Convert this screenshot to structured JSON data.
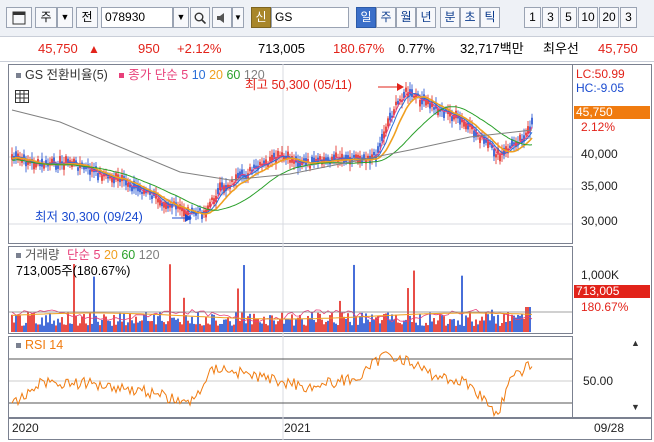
{
  "toolbar": {
    "type_label": "주",
    "code_label": "전",
    "code_value": "078930",
    "credit_badge": "신",
    "stock_name": "GS",
    "period_tabs": [
      "일",
      "주",
      "월",
      "년",
      "분",
      "초",
      "틱"
    ],
    "active_period": "일",
    "interval_numbers": [
      "1",
      "3",
      "5",
      "10",
      "20",
      "3"
    ]
  },
  "quote": {
    "price": "45,750",
    "change_arrow": "▲",
    "change": "950",
    "change_pct": "+2.12%",
    "volume": "713,005",
    "volume_ratio": "180.67%",
    "turnover": "0.77%",
    "amount": "32,717백만",
    "best_label": "최우선",
    "best_price": "45,750"
  },
  "price_panel": {
    "title": "GS 전환비율(5)",
    "ma_legend_prefix": "종가 단순",
    "ma_periods": [
      "5",
      "10",
      "20",
      "60",
      "120"
    ],
    "ma_colors": [
      "#e8407a",
      "#2a6fd8",
      "#f0a020",
      "#2aa02a",
      "#808080"
    ],
    "high_annotation": "최고 50,300 (05/11)",
    "low_annotation": "최저 30,300 (09/24)",
    "lc_label": "LC:50.99",
    "hc_label": "HC:-9.05",
    "current_price_tag": "45,750",
    "current_pct_tag": "2.12%",
    "y_ticks": [
      "40,000",
      "35,000",
      "30,000"
    ]
  },
  "volume_panel": {
    "legend_prefix": "거래량",
    "legend_ma_prefix": "단순",
    "legend_periods": [
      "5",
      "20",
      "60",
      "120"
    ],
    "summary": "713,005주(180.67%)",
    "y_tick": "1,000K",
    "current_tag": "713,005",
    "current_pct_tag": "180.67%"
  },
  "rsi_panel": {
    "title": "RSI 14",
    "y_tick": "50.00"
  },
  "date_axis": {
    "labels": [
      "2020",
      "2021"
    ],
    "right_label": "09/28"
  },
  "colors": {
    "up": "#e2231a",
    "down": "#1a4bd0",
    "ma5": "#e8407a",
    "ma10": "#2a6fd8",
    "ma20": "#f0a020",
    "ma60": "#2aa02a",
    "ma120": "#808080",
    "rsi": "#f07b0f",
    "current_tag_bg": "#f07b0f",
    "volume_tag_bg": "#e2231a"
  }
}
